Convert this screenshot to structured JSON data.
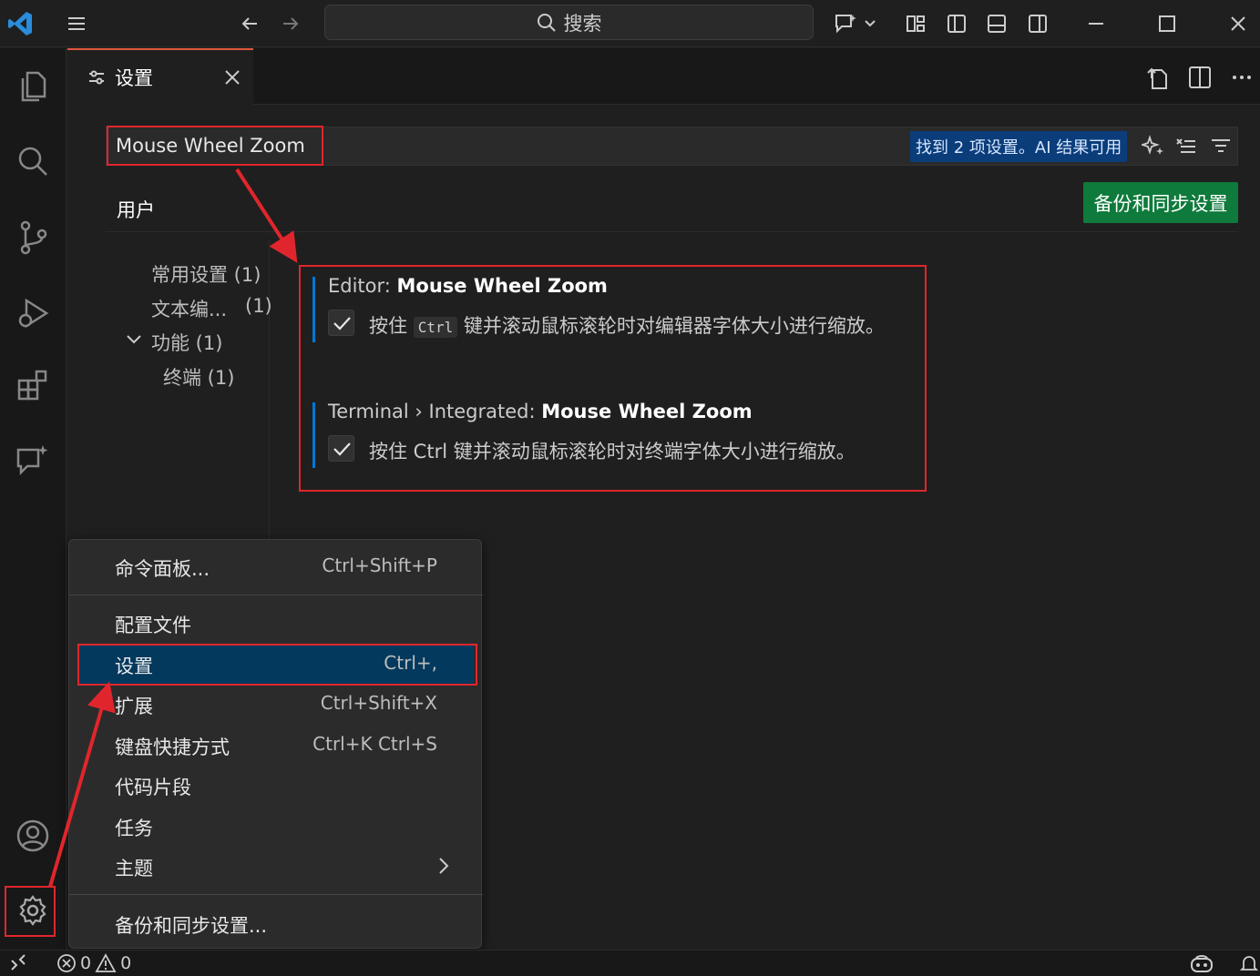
{
  "titlebar": {
    "search_label": "搜索",
    "icons": [
      "vscode-logo-icon",
      "menu-icon",
      "back-arrow-icon",
      "forward-arrow-icon",
      "search-icon",
      "copilot-chat-icon",
      "chevron-down-icon",
      "layout-customize-icon",
      "toggle-primary-sidebar-icon",
      "toggle-panel-icon",
      "toggle-secondary-sidebar-icon",
      "minimize-icon",
      "maximize-icon",
      "close-icon"
    ]
  },
  "activitybar": {
    "items": [
      "explorer-icon",
      "search-icon",
      "source-control-icon",
      "run-debug-icon",
      "extensions-icon",
      "chat-icon"
    ],
    "bottom": [
      "accounts-icon",
      "manage-gear-icon"
    ]
  },
  "tab": {
    "label": "设置",
    "icons": [
      "settings-editor-icon",
      "tab-close-icon"
    ],
    "actions": [
      "open-settings-json-icon",
      "split-editor-icon",
      "more-actions-icon"
    ]
  },
  "settings": {
    "search_value": "Mouse Wheel Zoom",
    "result_badge": "找到 2 项设置。AI 结果可用",
    "scope_tab": "用户",
    "sync_button": "备份和同步设置",
    "toc": [
      {
        "label": "常用设置 (1)"
      },
      {
        "label": "文本编...",
        "count": "(1)"
      },
      {
        "label": "功能 (1)"
      },
      {
        "label": "终端 (1)"
      }
    ],
    "items": [
      {
        "category": "Editor: ",
        "name": "Mouse Wheel Zoom",
        "checked": true,
        "desc_before": "按住 ",
        "desc_key": "Ctrl",
        "desc_after": " 键并滚动鼠标滚轮时对编辑器字体大小进行缩放。"
      },
      {
        "category": "Terminal › Integrated: ",
        "name": "Mouse Wheel Zoom",
        "checked": true,
        "desc": "按住 Ctrl 键并滚动鼠标滚轮时对终端字体大小进行缩放。"
      }
    ]
  },
  "menu": {
    "items": [
      {
        "label": "命令面板...",
        "shortcut": "Ctrl+Shift+P"
      },
      {
        "label": "配置文件",
        "shortcut": ""
      },
      {
        "label": "设置",
        "shortcut": "Ctrl+,"
      },
      {
        "label": "扩展",
        "shortcut": "Ctrl+Shift+X"
      },
      {
        "label": "键盘快捷方式",
        "shortcut": "Ctrl+K Ctrl+S"
      },
      {
        "label": "代码片段",
        "shortcut": ""
      },
      {
        "label": "任务",
        "shortcut": ""
      },
      {
        "label": "主题",
        "shortcut": ""
      },
      {
        "label": "备份和同步设置...",
        "shortcut": ""
      }
    ]
  },
  "statusbar": {
    "errors": "0",
    "warnings": "0"
  },
  "colors": {
    "annotation_red": "#e0262c",
    "accent_blue": "#0078d4",
    "sync_green": "#0e7a3b",
    "tab_top_border": "#e1583e"
  }
}
